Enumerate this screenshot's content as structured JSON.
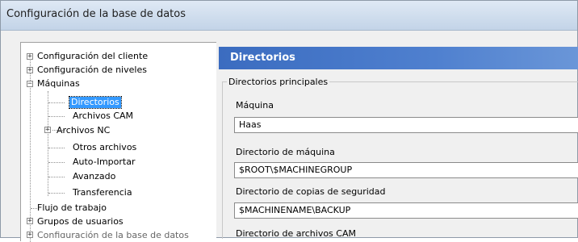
{
  "window": {
    "title": "Configuración de la base de datos"
  },
  "tree": {
    "items": [
      "Configuración del cliente",
      "Configuración de niveles",
      "Máquinas",
      "Directorios",
      "Archivos CAM",
      "Archivos NC",
      "Otros archivos",
      "Auto-Importar",
      "Avanzado",
      "Transferencia",
      "Flujo de trabajo",
      "Grupos de usuarios",
      "Configuración de la base de datos"
    ],
    "selected": "Directorios"
  },
  "panel": {
    "header": "Directorios",
    "group_label": "Directorios principales",
    "fields": [
      {
        "label": "Máquina",
        "value": "Haas"
      },
      {
        "label": "Directorio de máquina",
        "value": "$ROOT\\$MACHINEGROUP"
      },
      {
        "label": "Directorio de copias de seguridad",
        "value": "$MACHINENAME\\BACKUP"
      },
      {
        "label": "Directorio de archivos CAM",
        "value": ""
      }
    ]
  },
  "colors": {
    "header_bg": "#3b6cc0",
    "selection": "#3399ff"
  }
}
